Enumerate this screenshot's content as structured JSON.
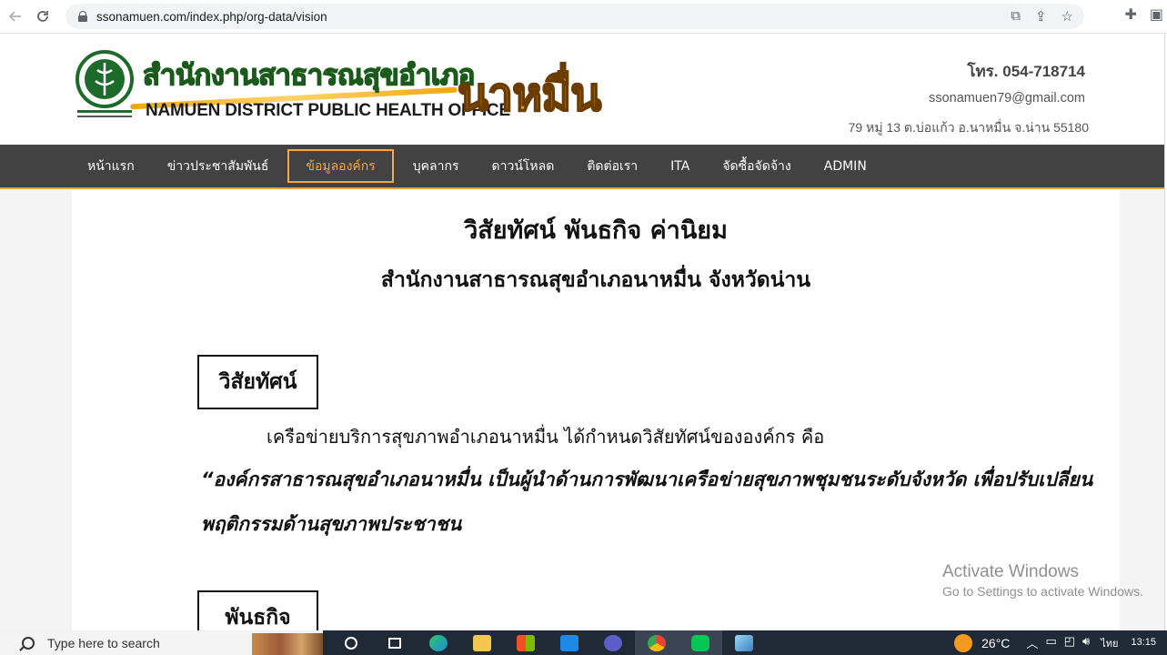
{
  "browser": {
    "url": "ssonamuen.com/index.php/org-data/vision",
    "back_icon": "arrow-left-icon",
    "reload_icon": "reload-icon"
  },
  "header": {
    "logo_th": "สำนักงานสาธารณสุขอำเภอ",
    "logo_en": "NAMUEN DISTRICT PUBLIC HEALTH OFFICE",
    "logo_big": "นาหมื่น",
    "phone": "โทร. 054-718714",
    "email": "ssonamuen79@gmail.com",
    "address": "79 หมู่ 13 ต.บ่อแก้ว อ.นาหมื่น จ.น่าน 55180"
  },
  "nav": {
    "items": [
      "หน้าแรก",
      "ข่าวประชาสัมพันธ์",
      "ข้อมูลองค์กร",
      "บุคลากร",
      "ดาวน์โหลด",
      "ติดต่อเรา",
      "ITA",
      "จัดซื้อจัดจ้าง",
      "ADMIN"
    ],
    "active_index": 2
  },
  "main": {
    "title": "วิสัยทัศน์  พันธกิจ  ค่านิยม",
    "subtitle": "สำนักงานสาธารณสุขอำเภอนาหมื่น  จังหวัดน่าน",
    "vision_heading": "วิสัยทัศน์",
    "vision_lead": "เครือข่ายบริการสุขภาพอำเภอนาหมื่น ได้กำหนดวิสัยทัศน์ขององค์กร คือ",
    "vision_quote_line1": "“องค์กรสาธารณสุขอำเภอนาหมื่น เป็นผู้นำด้านการพัฒนาเครือข่ายสุขภาพชุมชนระดับจังหวัด เพื่อปรับเปลี่ยน",
    "vision_quote_line2": "พฤติกรรมด้านสุขภาพประชาชน",
    "mission_heading": "พันธกิจ"
  },
  "watermark": {
    "line1": "Activate Windows",
    "line2": "Go to Settings to activate Windows."
  },
  "taskbar": {
    "search_placeholder": "Type here to search",
    "temperature": "26°C",
    "language": "ไทย",
    "time": "13:15"
  },
  "colors": {
    "nav_bg": "#424242",
    "accent": "#f5a742",
    "logo_orange": "#f5a100"
  }
}
